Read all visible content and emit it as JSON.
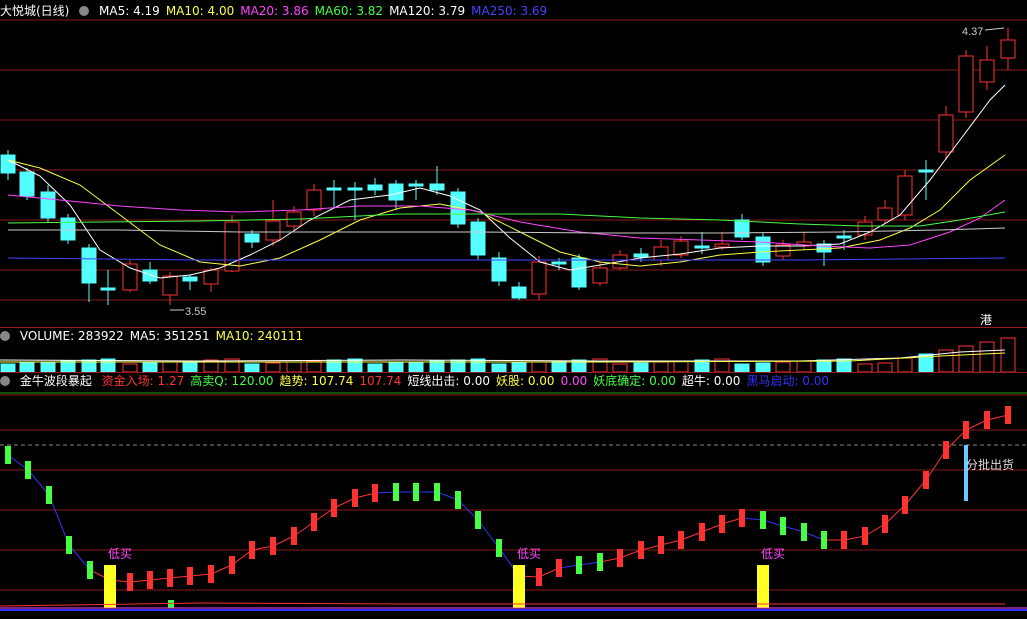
{
  "main": {
    "title": "大悦城(日线)",
    "ma": [
      {
        "label": "MA5: 4.19",
        "color": "#ffffff"
      },
      {
        "label": "MA10: 4.00",
        "color": "#ffff44"
      },
      {
        "label": "MA20: 3.86",
        "color": "#ff44ff"
      },
      {
        "label": "MA60: 3.82",
        "color": "#44ff44"
      },
      {
        "label": "MA120: 3.79",
        "color": "#ffffff"
      },
      {
        "label": "MA250: 3.69",
        "color": "#4444ff"
      }
    ],
    "high_label": "4.37",
    "low_label": "3.55",
    "gang": "港"
  },
  "volume": {
    "items": [
      {
        "label": "VOLUME: 283922",
        "color": "#ffffff"
      },
      {
        "label": "MA5: 351251",
        "color": "#ffffff"
      },
      {
        "label": "MA10: 240111",
        "color": "#ffff44"
      }
    ]
  },
  "indicator": {
    "name": "金牛波段暴起",
    "items": [
      {
        "label": "资金入场: 1.27",
        "color": "#ff3333"
      },
      {
        "label": "高卖Q: 120.00",
        "color": "#44ff44"
      },
      {
        "label": "趋势: 107.74",
        "color": "#ffff44"
      },
      {
        "label": "107.74",
        "color": "#ff3333"
      },
      {
        "label": "短线出击: 0.00",
        "color": "#ffffff"
      },
      {
        "label": "妖股: 0.00",
        "color": "#ffff44"
      },
      {
        "label": "0.00",
        "color": "#ff44ff"
      },
      {
        "label": "妖底确定: 0.00",
        "color": "#44ff44"
      },
      {
        "label": "超牛: 0.00",
        "color": "#ffffff"
      },
      {
        "label": "黑马启动: 0.00",
        "color": "#3333ff"
      }
    ],
    "buy_label": "低买",
    "sell_label": "分批出货"
  },
  "colors": {
    "up": "#ff3232",
    "down": "#54ffff",
    "grid": "#8b1a1a"
  }
}
